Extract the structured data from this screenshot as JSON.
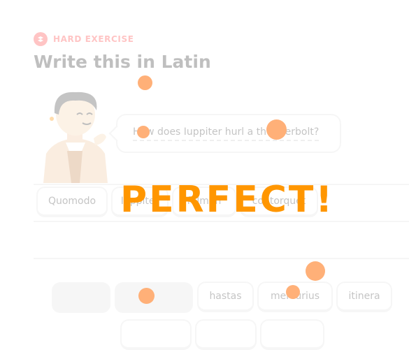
{
  "header": {
    "badge_icon": "exercise-icon",
    "badge_label": "HARD EXERCISE",
    "title": "Write this in Latin"
  },
  "prompt": {
    "character": "character-avatar",
    "sentence": "How does Iuppiter hurl a thunderbolt?"
  },
  "answer_tiles": [
    "Quomodo",
    "Iuppiter",
    "fulmen",
    "contorquet"
  ],
  "word_bank": [
    "",
    "",
    "hastas",
    "mercurius",
    "itinera",
    "",
    "",
    ""
  ],
  "feedback": {
    "text": "PERFECT!",
    "color": "#ff9600"
  },
  "colors": {
    "accent_red": "#ff4b4b",
    "particle": "#ffb078",
    "border": "#e5e5e5"
  }
}
